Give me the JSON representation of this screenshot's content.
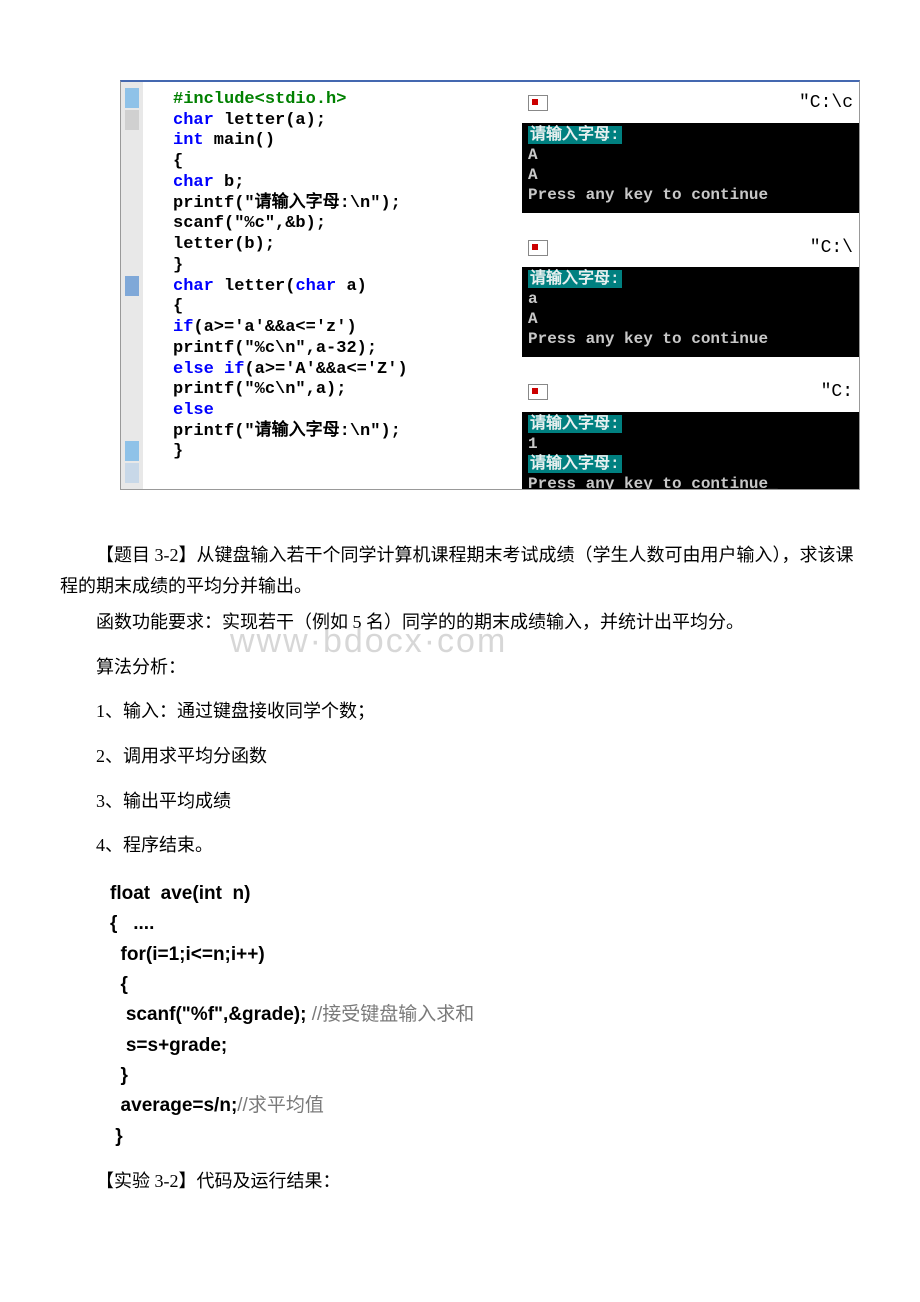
{
  "code1_lines": [
    [
      [
        "pre",
        "#include"
      ],
      [
        "pre",
        "<stdio.h>"
      ]
    ],
    [
      [
        "kw",
        "char"
      ],
      [
        "txt",
        " letter(a);"
      ]
    ],
    [
      [
        "kw",
        "int"
      ],
      [
        "txt",
        " main()"
      ]
    ],
    [
      [
        "txt",
        "{"
      ]
    ],
    [
      [
        "kw",
        "char"
      ],
      [
        "txt",
        " b;"
      ]
    ],
    [
      [
        "txt",
        "printf("
      ],
      [
        "str",
        "\"请输入字母:\\n\""
      ],
      [
        "txt",
        ");"
      ]
    ],
    [
      [
        "txt",
        "scanf("
      ],
      [
        "str",
        "\"%c\""
      ],
      [
        "txt",
        ",&b);"
      ]
    ],
    [
      [
        "txt",
        "letter(b);"
      ]
    ],
    [
      [
        "txt",
        "}"
      ]
    ],
    [
      [
        "kw",
        "char"
      ],
      [
        "txt",
        " letter("
      ],
      [
        "kw",
        "char"
      ],
      [
        "txt",
        " a)"
      ]
    ],
    [
      [
        "txt",
        "{"
      ]
    ],
    [
      [
        "kw",
        "if"
      ],
      [
        "txt",
        "(a>="
      ],
      [
        "str",
        "'a'"
      ],
      [
        "txt",
        "&&a<="
      ],
      [
        "str",
        "'z'"
      ],
      [
        "txt",
        ")"
      ]
    ],
    [
      [
        "txt",
        "printf("
      ],
      [
        "str",
        "\"%c\\n\""
      ],
      [
        "txt",
        ",a-32);"
      ]
    ],
    [
      [
        "kw",
        "else"
      ],
      [
        "txt",
        " "
      ],
      [
        "kw",
        "if"
      ],
      [
        "txt",
        "(a>="
      ],
      [
        "str",
        "'A'"
      ],
      [
        "txt",
        "&&a<="
      ],
      [
        "str",
        "'Z'"
      ],
      [
        "txt",
        ")"
      ]
    ],
    [
      [
        "txt",
        "printf("
      ],
      [
        "str",
        "\"%c\\n\""
      ],
      [
        "txt",
        ",a);"
      ]
    ],
    [
      [
        "kw",
        "else"
      ]
    ],
    [
      [
        "txt",
        "printf("
      ],
      [
        "str",
        "\"请输入字母:\\n\""
      ],
      [
        "txt",
        ");"
      ]
    ],
    [
      [
        "txt",
        "}"
      ]
    ]
  ],
  "term1": {
    "title": "\"C:\\c",
    "lines": [
      "请输入字母:",
      "A",
      "A",
      "Press any key to continue"
    ]
  },
  "term2": {
    "title": "\"C:\\",
    "lines": [
      "请输入字母:",
      "a",
      "A",
      "Press any key to continue"
    ]
  },
  "term3": {
    "title": "\"C:",
    "lines": [
      "请输入字母:",
      "1",
      "请输入字母:",
      "Press any key to continue_"
    ]
  },
  "q32_title": "【题目 3-2】从键盘输入若干个同学计算机课程期末考试成绩（学生人数可由用户输入），求该课程的期末成绩的平均分并输出。",
  "q32_req": "函数功能要求：实现若干（例如 5 名）同学的的期末成绩输入，并统计出平均分。",
  "algo_label": "算法分析：",
  "algo_steps": [
    "1、输入：通过键盘接收同学个数；",
    "2、调用求平均分函数",
    "3、输出平均成绩",
    "4、程序结束。"
  ],
  "snippet2": [
    {
      "t": "float  ave(int  n)",
      "c": ""
    },
    {
      "t": "{   ....",
      "c": ""
    },
    {
      "t": "  for(i=1;i<=n;i++)",
      "c": ""
    },
    {
      "t": "  {",
      "c": ""
    },
    {
      "t": "   scanf(\"%f\",&grade); ",
      "c": "//接受键盘输入求和"
    },
    {
      "t": "   s=s+grade;",
      "c": ""
    },
    {
      "t": "  }",
      "c": ""
    },
    {
      "t": "  average=s/n;",
      "c": "//求平均值"
    },
    {
      "t": " }",
      "c": ""
    }
  ],
  "exp32_label": "【实验 3-2】代码及运行结果：",
  "watermark": "www·bdocx·com"
}
